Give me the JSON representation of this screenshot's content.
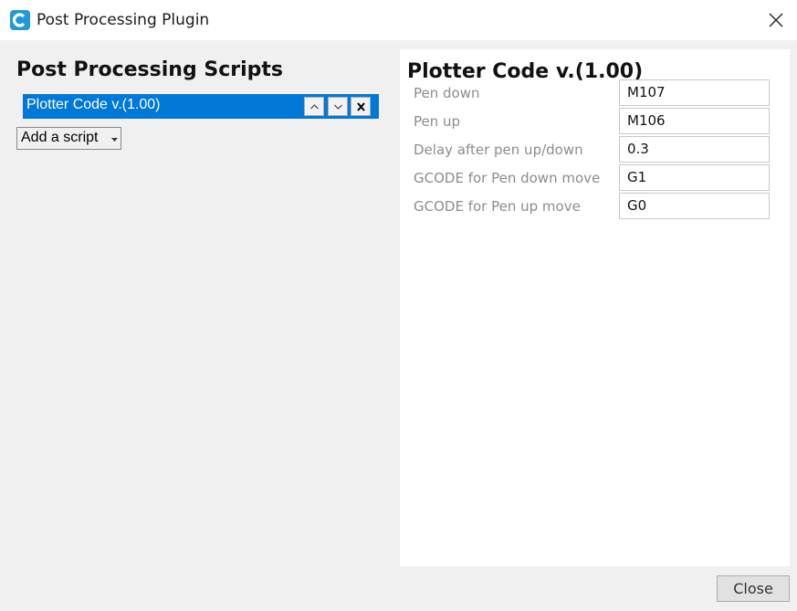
{
  "window": {
    "title": "Post Processing Plugin",
    "icon": "cura-logo-icon",
    "accent_color": "#1e9bd7"
  },
  "left": {
    "heading": "Post Processing Scripts",
    "scripts": [
      {
        "label": "Plotter Code v.(1.00)",
        "selected": true
      }
    ],
    "selection_color": "#0078d7",
    "add_button_label": "Add a script"
  },
  "right": {
    "heading": "Plotter Code v.(1.00)",
    "settings": [
      {
        "label": "Pen down",
        "value": "M107"
      },
      {
        "label": "Pen up",
        "value": "M106"
      },
      {
        "label": "Delay after pen up/down",
        "value": "0.3"
      },
      {
        "label": "GCODE for Pen down move",
        "value": "G1"
      },
      {
        "label": "GCODE for Pen up move",
        "value": "G0"
      }
    ]
  },
  "footer": {
    "close_label": "Close"
  }
}
